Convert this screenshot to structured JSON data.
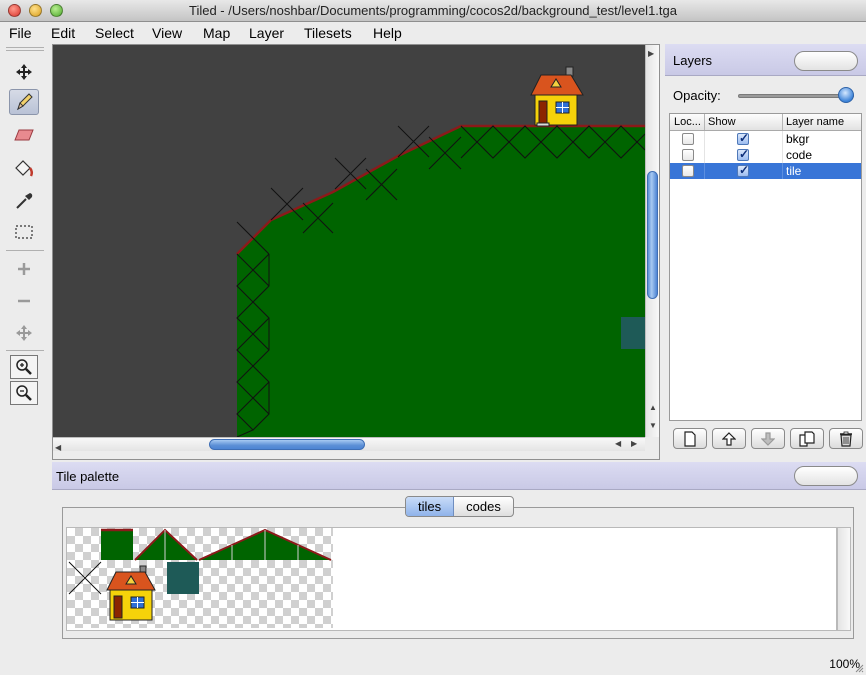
{
  "window": {
    "title": "Tiled - /Users/noshbar/Documents/programming/cocos2d/background_test/level1.tga"
  },
  "menu": [
    "File",
    "Edit",
    "Select",
    "View",
    "Map",
    "Layer",
    "Tilesets",
    "Help"
  ],
  "tools": [
    "move-tool",
    "stamp-brush",
    "eraser",
    "bucket-fill",
    "eyedropper",
    "rectangle-select",
    "add-tile",
    "remove-tile",
    "move-object",
    "zoom-in",
    "zoom-out"
  ],
  "layers_panel": {
    "title": "Layers",
    "opacity_label": "Opacity:",
    "opacity_value": 1.0,
    "columns": [
      "Loc...",
      "Show",
      "Layer name"
    ],
    "rows": [
      {
        "name": "bkgr",
        "locked": false,
        "visible": true,
        "selected": false
      },
      {
        "name": "code",
        "locked": false,
        "visible": true,
        "selected": false
      },
      {
        "name": "tile",
        "locked": false,
        "visible": true,
        "selected": true
      }
    ],
    "buttons": [
      "new-layer",
      "move-layer-up",
      "move-layer-down",
      "duplicate-layer",
      "delete-layer"
    ]
  },
  "palette": {
    "title": "Tile palette",
    "tabs": [
      "tiles",
      "codes"
    ],
    "active_tab": "tiles"
  },
  "colors": {
    "map_background": "#414141",
    "grass": "#006400",
    "ridge": "#8b1a1a",
    "selection": "#3875d7",
    "header": "#cfcfea"
  },
  "status": {
    "zoom": "100%"
  }
}
